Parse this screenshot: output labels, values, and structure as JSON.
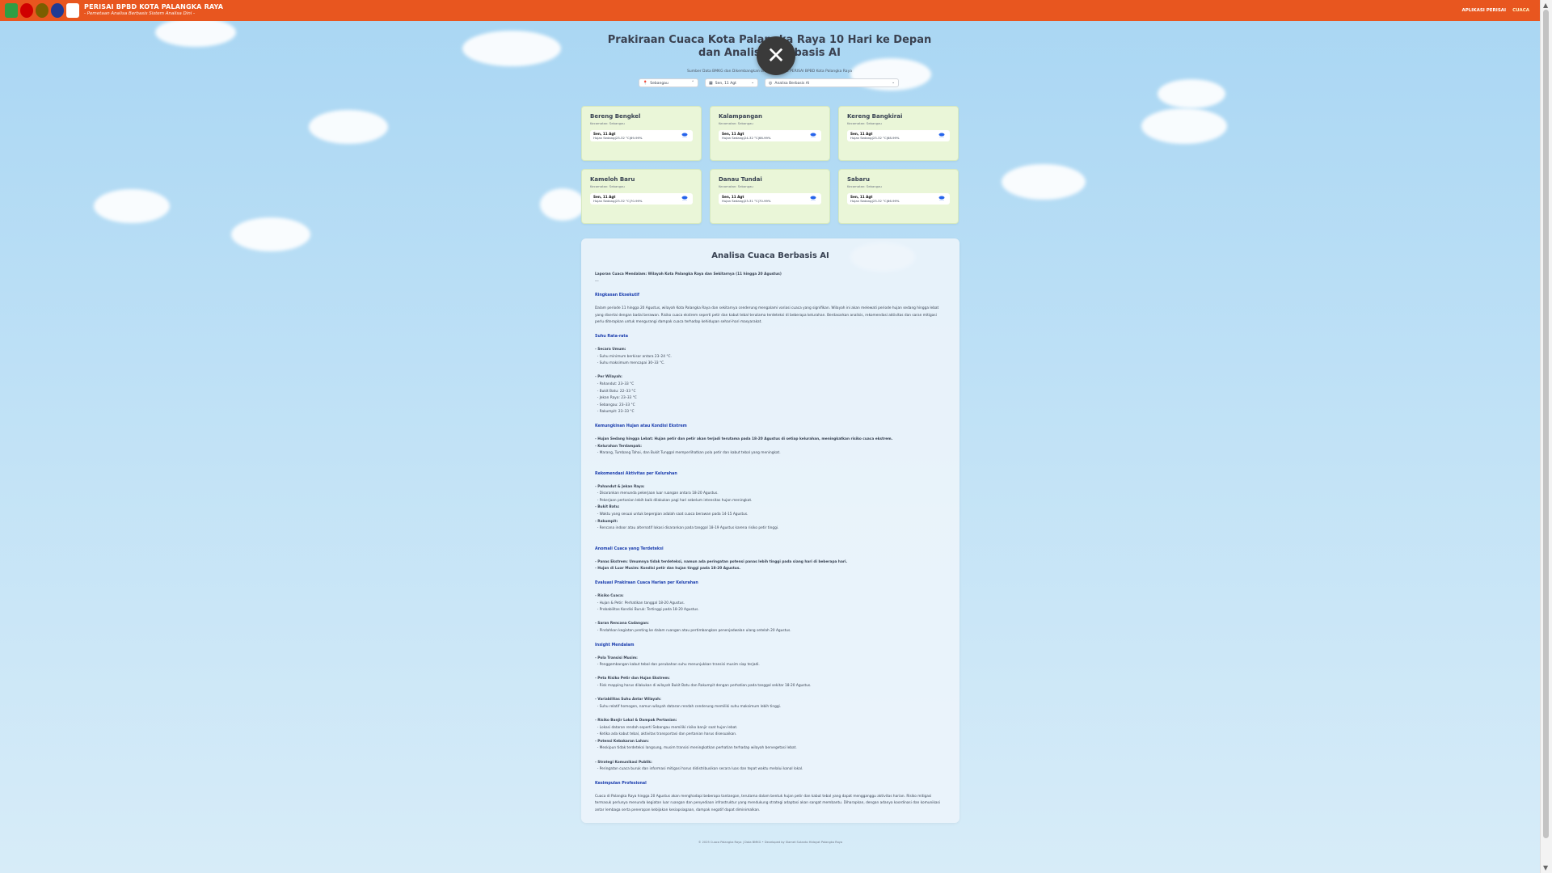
{
  "header": {
    "brand_title": "PERISAI BPBD KOTA PALANGKA RAYA",
    "brand_subtitle": "- Pemetaan Analisa Berbasis Sistem Analisa Dini -",
    "nav": [
      "APLIKASI PERISAI",
      "CUACA"
    ]
  },
  "hero": {
    "title_line1": "Prakiraan Cuaca Kota Palangka Raya 10 Hari ke Depan",
    "title_line2": "dan Analisis Berbasis AI",
    "source": "Sumber Data BMKG dan Dikembangkan oleh Tim Teknis PERISAI BPBD Kota Palangka Raya"
  },
  "filters": {
    "location": "Sebangau",
    "date": "Sen, 11 Agt",
    "mode": "Analisa Berbasis AI"
  },
  "cards": [
    {
      "name": "Bereng Bengkel",
      "kec": "Kecamatan: Sebangau",
      "date": "Sen, 11 Agt",
      "weather": "Hujan Sedang|23-32 °C|69-99%"
    },
    {
      "name": "Kalampangan",
      "kec": "Kecamatan: Sebangau",
      "date": "Sen, 11 Agt",
      "weather": "Hujan Sedang|24-32 °C|66-99%"
    },
    {
      "name": "Kereng Bangkirai",
      "kec": "Kecamatan: Sebangau",
      "date": "Sen, 11 Agt",
      "weather": "Hujan Sedang|23-32 °C|68-99%"
    },
    {
      "name": "Kameloh Baru",
      "kec": "Kecamatan: Sebangau",
      "date": "Sen, 11 Agt",
      "weather": "Hujan Sedang|23-32 °C|70-99%"
    },
    {
      "name": "Danau Tundai",
      "kec": "Kecamatan: Sebangau",
      "date": "Sen, 11 Agt",
      "weather": "Hujan Sedang|23-31 °C|70-99%"
    },
    {
      "name": "Sabaru",
      "kec": "Kecamatan: Sebangau",
      "date": "Sen, 11 Agt",
      "weather": "Hujan Sedang|23-32 °C|66-99%"
    }
  ],
  "analysis": {
    "title": "Analisa Cuaca Berbasis AI",
    "lead": "Laporan Cuaca Mendalam: Wilayah Kota Palangka Raya dan Sekitarnya (11 hingga 20 Agustus)",
    "sep": "---",
    "s1": "Ringkasan Eksekutif",
    "s1_p": "Dalam periode 11 hingga 20 Agustus, wilayah Kota Palangka Raya dan sekitarnya cenderung mengalami variasi cuaca yang signifikan. Wilayah ini akan melewati periode hujan sedang hingga lebat yang disertai dengan badai berawan. Risiko cuaca ekstrem seperti petir dan kabut tebal terutama terdeteksi di beberapa kelurahan. Berdasarkan analisis, rekomendasi aktivitas dan saran mitigasi perlu diterapkan untuk mengurangi dampak cuaca terhadap kehidupan sehari-hari masyarakat.",
    "s2": "Suhu Rata-rata",
    "s2_lines": [
      "- Secara Umum:",
      "  - Suhu minimum berkisar antara 23–24 °C.",
      "  - Suhu maksimum mencapai 30–33 °C.",
      "",
      "- Per Wilayah:",
      "  - Pahandut: 23–33 °C",
      "  - Bukit Batu: 22–33 °C",
      "  - Jekan Raya: 23–33 °C",
      "  - Sebangau: 23–33 °C",
      "  - Rakumpit: 23–33 °C"
    ],
    "s3": "Kemungkinan Hujan atau Kondisi Ekstrem",
    "s3_lines": [
      "- Hujan Sedang hingga Lebat: Hujan petir dan petir akan terjadi terutama pada 18-20 Agustus di setiap kelurahan, meningkatkan risiko cuaca ekstrem.",
      "- Kelurahan Terdampak:",
      "  - Marang, Tumbang Tahai, dan Bukit Tunggal memperlihatkan pola petir dan kabut tebal yang meningkat."
    ],
    "s4": "Rekomendasi Aktivitas per Kelurahan",
    "s4_lines": [
      "- Pahandut & Jekan Raya:",
      "  - Disarankan menunda pekerjaan luar ruangan antara 18-20 Agustus.",
      "  - Pekerjaan pertanian lebih baik dilakukan pagi hari sebelum intensitas hujan meningkat.",
      "- Bukit Batu:",
      "  - Waktu yang sesuai untuk bepergian adalah saat cuaca berawan pada 14-15 Agustus.",
      "- Rakumpit:",
      "  - Rencana indoor atau alternatif lokasi disarankan pada tanggal 18-19 Agustus karena risiko petir tinggi."
    ],
    "s5": "Anomali Cuaca yang Terdeteksi",
    "s5_lines": [
      "- Panas Ekstrem: Umumnya tidak terdeteksi, namun ada peringatan potensi panas lebih tinggi pada siang hari di beberapa hari.",
      "- Hujan di Luar Musim: Kondisi petir dan hujan tinggi pada 18-20 Agustus."
    ],
    "s6": "Evaluasi Prakiraan Cuaca Harian per Kelurahan",
    "s6_lines": [
      "- Risiko Cuaca:",
      "  - Hujan & Petir: Perhatikan tanggal 18-20 Agustus.",
      "  - Probabilitas Kondisi Buruk: Tertinggi pada 18-20 Agustus.",
      "",
      "- Saran Rencana Cadangan:",
      "  - Pindahkan kegiatan penting ke dalam ruangan atau pertimbangkan penenjadwalan ulang setelah 20 Agustus."
    ],
    "s7": "Insight Mendalam",
    "s7_lines": [
      "- Pola Transisi Musim:",
      "  - Penggembangan kabut tebal dan perubahan suhu menunjukkan transisi musim siap terjadi.",
      "",
      "- Peta Risiko Petir dan Hujan Ekstrem:",
      "  - Risk mapping harus dilakukan di wilayah Bukit Batu dan Rakumpit dengan perhatian pada tanggal sekitar 18-20 Agustus.",
      "",
      "- Variabilitas Suhu Antar Wilayah:",
      "  - Suhu relatif homogen, namun wilayah dataran rendah cenderung memiliki suhu maksimum lebih tinggi.",
      "",
      "- Risiko Banjir Lokal & Dampak Pertanian:",
      "  - Lokasi dataran rendah seperti Sebangau memiliki risiko banjir saat hujan lebat.",
      "  - Ketika ada kabut tebal, aktivitas transportasi dan pertanian harus disesuaikan.",
      "- Potensi Kebakaran Lahan:",
      "  - Meskipun tidak terdeteksi langsung, musim transisi meningkatkan perhatian terhadap wilayah bervegetasi lebat.",
      "",
      "- Strategi Komunikasi Publik:",
      "  - Peringatan cuaca buruk dan informasi mitigasi harus didistribusikan secara luas dan tepat waktu melalui kanal lokal."
    ],
    "s8": "Kesimpulan Profesional",
    "s8_p": "Cuaca di Palangka Raya hingga 20 Agustus akan menghadapi beberapa tantangan, terutama dalam bentuk hujan petir dan kabut tebal yang dapat mengganggu aktivitas harian. Risiko mitigasi termasuk perlunya menunda kegiatan luar ruangan dan penyediaan infrastruktur yang mendukung strategi adaptasi akan sangat membantu. Diharapkan, dengan adanya koordinasi dan komunikasi antar lembaga serta penerapan kebijakan kesiapsiagaan, dampak negatif dapat diminimalkan."
  },
  "footer": "© 2025 Cuaca Palangka Raya | Data BMKG • Developed by Slamet Sutanto Hidayat Palangka Raya",
  "colors": {
    "accent": "#e8561f",
    "card_bg": "#eaf6d8",
    "section_heading": "#1e40af"
  }
}
